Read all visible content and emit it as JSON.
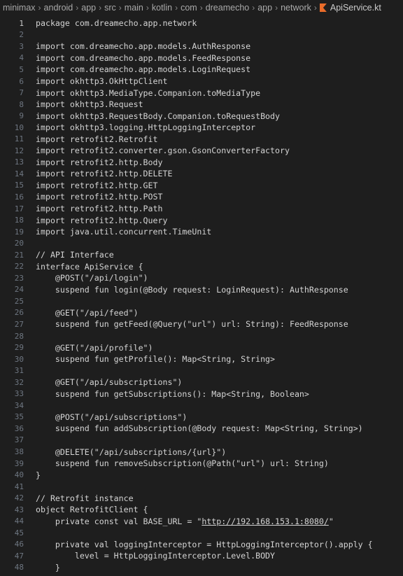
{
  "breadcrumb": {
    "segments": [
      "minimax",
      "android",
      "app",
      "src",
      "main",
      "kotlin",
      "com",
      "dreamecho",
      "app",
      "network"
    ],
    "file": "ApiService.kt",
    "separator": "›"
  },
  "editor": {
    "active_line": 1,
    "lines": [
      {
        "n": "1",
        "text": "package com.dreamecho.app.network"
      },
      {
        "n": "2",
        "text": ""
      },
      {
        "n": "3",
        "text": "import com.dreamecho.app.models.AuthResponse"
      },
      {
        "n": "4",
        "text": "import com.dreamecho.app.models.FeedResponse"
      },
      {
        "n": "5",
        "text": "import com.dreamecho.app.models.LoginRequest"
      },
      {
        "n": "6",
        "text": "import okhttp3.OkHttpClient"
      },
      {
        "n": "7",
        "text": "import okhttp3.MediaType.Companion.toMediaType"
      },
      {
        "n": "8",
        "text": "import okhttp3.Request"
      },
      {
        "n": "9",
        "text": "import okhttp3.RequestBody.Companion.toRequestBody"
      },
      {
        "n": "10",
        "text": "import okhttp3.logging.HttpLoggingInterceptor"
      },
      {
        "n": "11",
        "text": "import retrofit2.Retrofit"
      },
      {
        "n": "12",
        "text": "import retrofit2.converter.gson.GsonConverterFactory"
      },
      {
        "n": "13",
        "text": "import retrofit2.http.Body"
      },
      {
        "n": "14",
        "text": "import retrofit2.http.DELETE"
      },
      {
        "n": "15",
        "text": "import retrofit2.http.GET"
      },
      {
        "n": "16",
        "text": "import retrofit2.http.POST"
      },
      {
        "n": "17",
        "text": "import retrofit2.http.Path"
      },
      {
        "n": "18",
        "text": "import retrofit2.http.Query"
      },
      {
        "n": "19",
        "text": "import java.util.concurrent.TimeUnit"
      },
      {
        "n": "20",
        "text": ""
      },
      {
        "n": "21",
        "text": "// API Interface"
      },
      {
        "n": "22",
        "text": "interface ApiService {"
      },
      {
        "n": "23",
        "text": "    @POST(\"/api/login\")"
      },
      {
        "n": "24",
        "text": "    suspend fun login(@Body request: LoginRequest): AuthResponse"
      },
      {
        "n": "25",
        "text": ""
      },
      {
        "n": "26",
        "text": "    @GET(\"/api/feed\")"
      },
      {
        "n": "27",
        "text": "    suspend fun getFeed(@Query(\"url\") url: String): FeedResponse"
      },
      {
        "n": "28",
        "text": ""
      },
      {
        "n": "29",
        "text": "    @GET(\"/api/profile\")"
      },
      {
        "n": "30",
        "text": "    suspend fun getProfile(): Map<String, String>"
      },
      {
        "n": "31",
        "text": ""
      },
      {
        "n": "32",
        "text": "    @GET(\"/api/subscriptions\")"
      },
      {
        "n": "33",
        "text": "    suspend fun getSubscriptions(): Map<String, Boolean>"
      },
      {
        "n": "34",
        "text": ""
      },
      {
        "n": "35",
        "text": "    @POST(\"/api/subscriptions\")"
      },
      {
        "n": "36",
        "text": "    suspend fun addSubscription(@Body request: Map<String, String>)"
      },
      {
        "n": "37",
        "text": ""
      },
      {
        "n": "38",
        "text": "    @DELETE(\"/api/subscriptions/{url}\")"
      },
      {
        "n": "39",
        "text": "    suspend fun removeSubscription(@Path(\"url\") url: String)"
      },
      {
        "n": "40",
        "text": "}"
      },
      {
        "n": "41",
        "text": ""
      },
      {
        "n": "42",
        "text": "// Retrofit instance"
      },
      {
        "n": "43",
        "text": "object RetrofitClient {"
      },
      {
        "n": "44",
        "text": "    private const val BASE_URL = \"http://192.168.153.1:8080/\""
      },
      {
        "n": "45",
        "text": ""
      },
      {
        "n": "46",
        "text": "    private val loggingInterceptor = HttpLoggingInterceptor().apply {"
      },
      {
        "n": "47",
        "text": "        level = HttpLoggingInterceptor.Level.BODY"
      },
      {
        "n": "48",
        "text": "    }"
      }
    ]
  }
}
